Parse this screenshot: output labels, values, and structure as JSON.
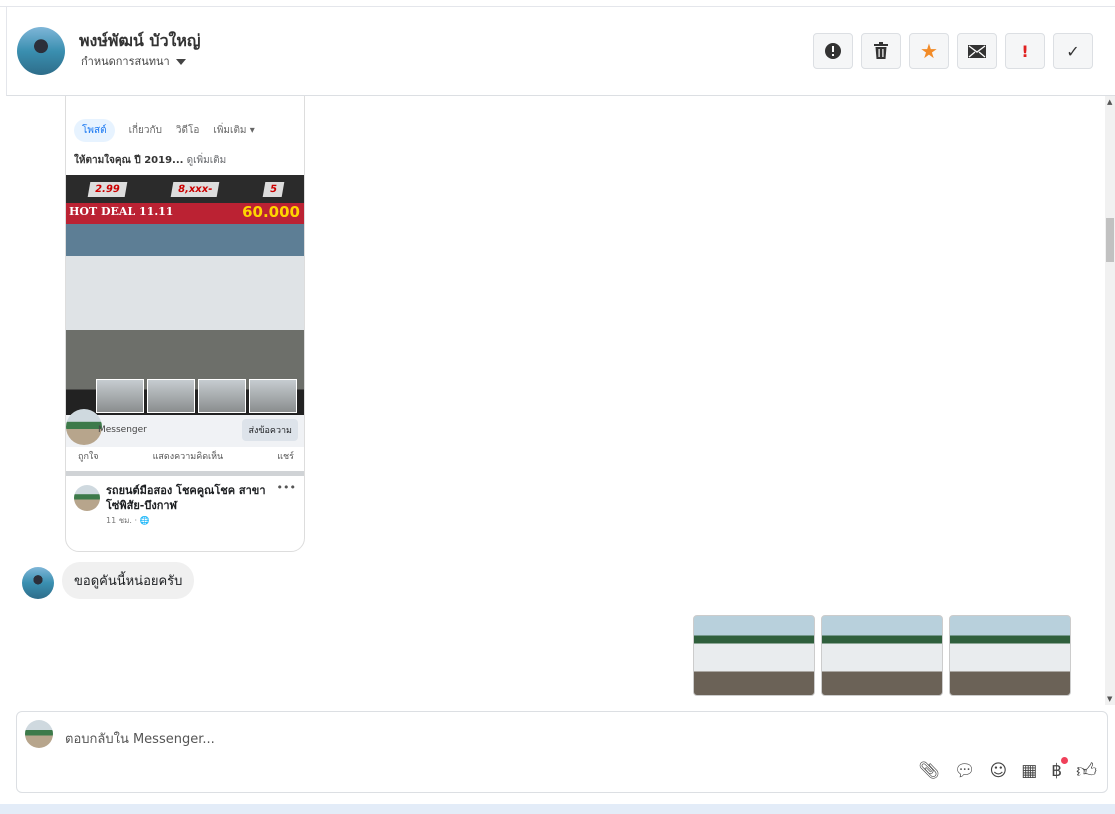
{
  "header": {
    "name": "พงษ์พัฒน์ บัวใหญ่",
    "subtitle": "กำหนดการสนทนา",
    "buttons": [
      {
        "name": "alert",
        "icon": "⬤"
      },
      {
        "name": "delete",
        "icon": "🗑"
      },
      {
        "name": "star",
        "icon": "★"
      },
      {
        "name": "mail",
        "icon": "✉"
      },
      {
        "name": "important",
        "icon": "!"
      },
      {
        "name": "done",
        "icon": "✓"
      }
    ]
  },
  "shared_post": {
    "tabs": [
      "โพสต์",
      "เกี่ยวกับ",
      "วิดีโอ",
      "เพิ่มเติม ▾"
    ],
    "desc": "ให้ตามใจคุณ ปี 2019...",
    "see_more": "ดูเพิ่มเติม",
    "promo": [
      "2.99",
      "8,xxx-",
      "5"
    ],
    "hot_deal": "HOT DEAL 11.11",
    "price": "60.000",
    "messenger_label": "Messenger",
    "send_message": "ส่งข้อความ",
    "actions": [
      "ถูกใจ",
      "แสดงความคิดเห็น",
      "แชร์"
    ],
    "page_name": "รถยนต์มือสอง โชคคูณโชค สาขา โซ่พิสัย-บึงกาฬ",
    "time": "11 ชม. · 🌐"
  },
  "messages": [
    {
      "text": "ขอดูคันนี้หน่อยครับ"
    }
  ],
  "composer": {
    "placeholder": "ตอบกลับใน Messenger...",
    "icons": [
      "paperclip-icon",
      "chat-icon",
      "emoji-icon",
      "table-icon",
      "baht-icon",
      "like-icon"
    ]
  },
  "colors": {
    "star": "#f28b28",
    "important": "#e02020",
    "notification": "#f0405a"
  }
}
